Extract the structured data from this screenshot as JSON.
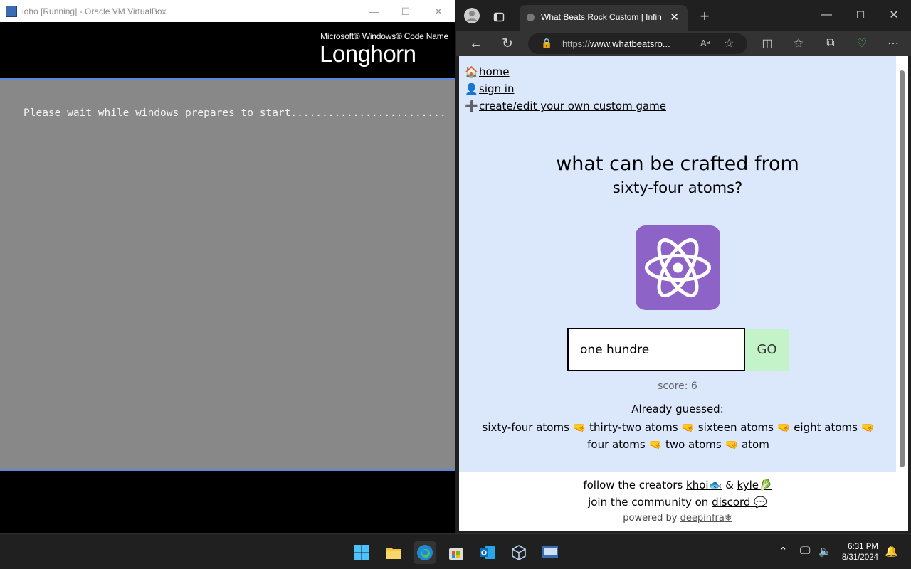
{
  "vbox": {
    "title": "loho [Running] - Oracle VM VirtualBox",
    "logo_line1": "Microsoft® Windows® Code Name",
    "logo_line2": "Longhorn",
    "message": "Please wait while windows prepares to start........................."
  },
  "browser": {
    "tab_title": "What Beats Rock Custom | Infinite",
    "url_prefix": "https://",
    "url_host": "www.whatbeatsro..."
  },
  "page": {
    "nav": [
      {
        "icon": "🏠",
        "label": "home"
      },
      {
        "icon": "👤",
        "label": "sign in"
      },
      {
        "icon": "➕",
        "label": "create/edit your own custom game"
      }
    ],
    "question_line1": "what can be crafted from",
    "question_line2": "sixty-four atoms?",
    "input_value": "one hundre",
    "go_label": "GO",
    "score": "score: 6",
    "already_guessed_label": "Already guessed:",
    "guesses": [
      "sixty-four atoms",
      "thirty-two atoms",
      "sixteen atoms",
      "eight atoms",
      "four atoms",
      "two atoms",
      "atom"
    ],
    "separator": "🤜",
    "footer": {
      "follow_text": "follow the creators",
      "creator1": "khoi",
      "creator1_emoji": "🐟",
      "amp": "&",
      "creator2": "kyle",
      "creator2_emoji": "🥬",
      "join_text": "join the community on",
      "discord": "discord",
      "discord_emoji": "💬",
      "powered_text": "powered by",
      "deepinfra": "deepinfra",
      "deepinfra_emoji": "❄"
    }
  },
  "taskbar": {
    "time": "6:31 PM",
    "date": "8/31/2024"
  },
  "colors": {
    "page_bg": "#dbe8fb",
    "atom_tile": "#8e63c8",
    "go_button": "#c4f2c9",
    "longhorn_band": "#888888"
  }
}
